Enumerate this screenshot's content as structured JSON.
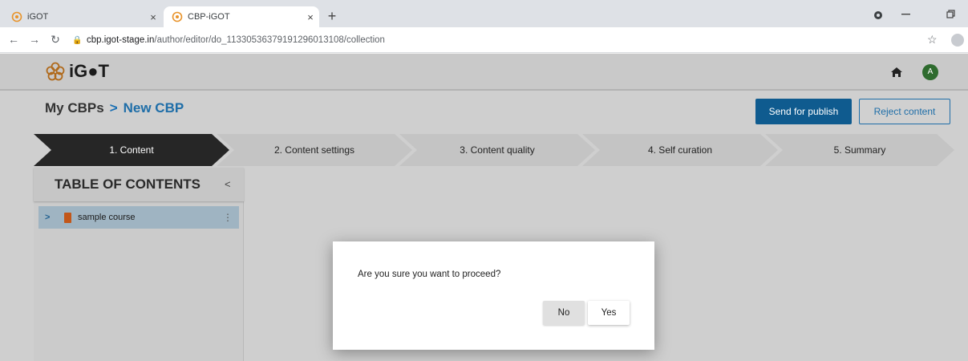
{
  "browser": {
    "tabs": [
      {
        "title": "iGOT",
        "icon": "igot-favicon",
        "active": false
      },
      {
        "title": "CBP-iGOT",
        "icon": "igot-favicon",
        "active": true
      }
    ],
    "new_tab_label": "+",
    "close_label": "×",
    "url_domain": "cbp.igot-stage.in",
    "url_path": "/author/editor/do_11330536379191296013108/collection"
  },
  "app": {
    "logo_text": "iG●T",
    "avatar_initial": "A",
    "breadcrumb": {
      "root": "My CBPs",
      "separator": ">",
      "current": "New CBP"
    },
    "actions": {
      "publish_label": "Send for publish",
      "reject_label": "Reject content"
    },
    "steps": [
      {
        "label": "1. Content",
        "active": true
      },
      {
        "label": "2. Content settings",
        "active": false
      },
      {
        "label": "3. Content quality",
        "active": false
      },
      {
        "label": "4. Self curation",
        "active": false
      },
      {
        "label": "5. Summary",
        "active": false
      }
    ],
    "toc": {
      "title": "TABLE OF CONTENTS",
      "collapse_label": "<",
      "items": [
        {
          "label": "sample course",
          "expand_label": ">",
          "menu_label": "⋮"
        }
      ]
    }
  },
  "modal": {
    "message": "Are you sure you want to proceed?",
    "no_label": "No",
    "yes_label": "Yes"
  },
  "colors": {
    "primary": "#0f5b8f",
    "accent_blue": "#1f6ea8",
    "active_step": "#262626",
    "avatar_green": "#2e6b2e"
  }
}
